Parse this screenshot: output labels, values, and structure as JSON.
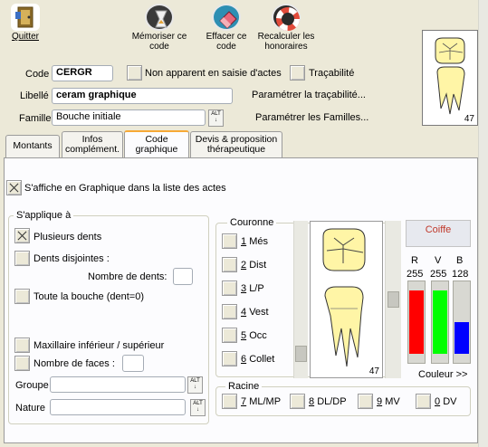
{
  "toolbar": {
    "quit": "Quitter",
    "memorize": "Mémoriser ce code",
    "clear": "Effacer ce code",
    "recalc": "Recalculer les honoraires"
  },
  "form": {
    "code_label": "Code",
    "code_value": "CERGR",
    "not_visible_label": "Non apparent en saisie d'actes",
    "traceability_label": "Traçabilité",
    "libelle_label": "Libellé",
    "libelle_value": "ceram graphique",
    "param_trace_link": "Paramétrer la traçabilité...",
    "famille_label": "Famille",
    "famille_value": "Bouche initiale",
    "param_famille_link": "Paramétrer les Familles...",
    "alt_label": "ALT"
  },
  "tooth_preview_number": "47",
  "tabs": [
    {
      "label": "Montants"
    },
    {
      "label": "Infos complément."
    },
    {
      "label": "Code graphique"
    },
    {
      "label": "Devis & proposition thérapeutique"
    }
  ],
  "graphic": {
    "affiche_label": "S'affiche en Graphique dans la liste des actes",
    "applies_title": "S'applique à",
    "plusieurs": "Plusieurs dents",
    "disjointes": "Dents disjointes :",
    "nombre_dents_label": "Nombre de dents:",
    "toute_bouche": "Toute la bouche (dent=0)",
    "maxillaire": "Maxillaire inférieur / supérieur",
    "nombre_faces": "Nombre de faces :",
    "groupe_label": "Groupe",
    "nature_label": "Nature",
    "couronne_title": "Couronne",
    "couronne_items": [
      {
        "num": "1",
        "label": "Més"
      },
      {
        "num": "2",
        "label": "Dist"
      },
      {
        "num": "3",
        "label": "L/P"
      },
      {
        "num": "4",
        "label": "Vest"
      },
      {
        "num": "5",
        "label": "Occ"
      },
      {
        "num": "6",
        "label": "Collet"
      }
    ],
    "tooth_number": "47",
    "racine_title": "Racine",
    "racine_items": [
      {
        "num": "7",
        "label": "ML/MP"
      },
      {
        "num": "8",
        "label": "DL/DP"
      },
      {
        "num": "9",
        "label": "MV"
      },
      {
        "num": "0",
        "label": "DV"
      }
    ],
    "color_name": "Coiffe",
    "rgb_labels": [
      "R",
      "V",
      "B"
    ],
    "rgb_values": [
      "255",
      "255",
      "128"
    ],
    "couleur_link": "Couleur >>"
  },
  "colors": {
    "accent_tab": "#f7a936",
    "color_name_text": "#c0392b",
    "tooth_fill": "#fff5a6"
  }
}
